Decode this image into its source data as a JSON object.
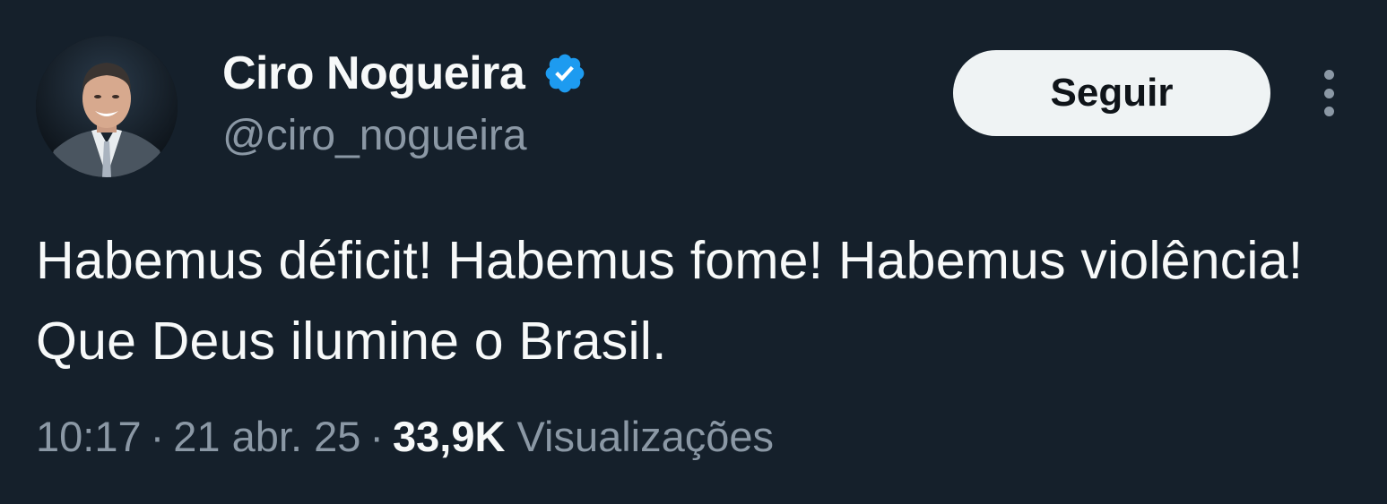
{
  "tweet": {
    "author": {
      "display_name": "Ciro Nogueira",
      "handle": "@ciro_nogueira",
      "verified": true,
      "avatar_icon": "profile-photo"
    },
    "follow_label": "Seguir",
    "more_icon": "more-vertical-icon",
    "text": "Habemus déficit! Habemus fome! Habemus violência! Que Deus ilumine o Brasil.",
    "time": "10:17",
    "separator": "·",
    "date": "21 abr. 25",
    "views_count": "33,9K",
    "views_label": "Visualizações"
  },
  "colors": {
    "background": "#15202b",
    "text_primary": "#f7f9f9",
    "text_secondary": "#8b98a5",
    "verified_blue": "#1d9bf0",
    "button_bg": "#eff3f4",
    "button_text": "#0f1419"
  }
}
